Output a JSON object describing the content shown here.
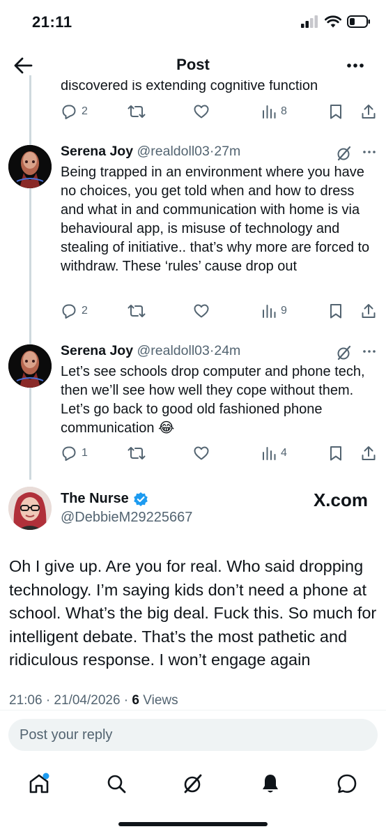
{
  "status_bar": {
    "time": "21:11"
  },
  "header": {
    "title": "Post"
  },
  "thread": {
    "partial_tweet": {
      "text": "discovered is extending cognitive function",
      "actions": {
        "replies": "2",
        "views": "8"
      }
    },
    "replies": [
      {
        "name": "Serena Joy",
        "handle": "@realdoll03",
        "time": "27m",
        "text": "Being trapped in an environment where you have no choices, you get told when and how to dress and what in and communication with home is via behavioural app, is misuse of technology and stealing of initiative.. that’s why more are forced to withdraw. These ‘rules’ cause drop out",
        "actions": {
          "replies": "2",
          "views": "9"
        }
      },
      {
        "name": "Serena Joy",
        "handle": "@realdoll03",
        "time": "24m",
        "text": "Let’s see schools drop computer and phone tech, then we’ll see how well they cope without them. Let’s go back to good old fashioned phone communication 😂",
        "actions": {
          "replies": "1",
          "views": "4"
        }
      }
    ]
  },
  "main_post": {
    "name": "The Nurse",
    "handle": "@DebbieM29225667",
    "source": "X.com",
    "text": "Oh I give up. Are you for real. Who said dropping technology. I’m saying kids don’t need a phone at school. What’s the big deal. Fuck this. So much for intelligent debate. That’s the most pathetic and ridiculous response. I won’t engage again",
    "timestamp": "21:06 · 21/04/2026 · ",
    "views_count": "6",
    "views_label": " Views"
  },
  "reply_input": {
    "placeholder": "Post your reply"
  },
  "colors": {
    "text": "#0f1419",
    "secondary": "#536471",
    "accent": "#1d9bf0",
    "divider": "#eff3f4"
  },
  "icons": [
    "back-arrow-icon",
    "more-icon",
    "reply-icon",
    "retweet-icon",
    "like-icon",
    "views-icon",
    "bookmark-icon",
    "share-icon",
    "grok-icon",
    "verified-badge-icon",
    "home-icon",
    "search-icon",
    "notifications-icon",
    "messages-icon"
  ]
}
